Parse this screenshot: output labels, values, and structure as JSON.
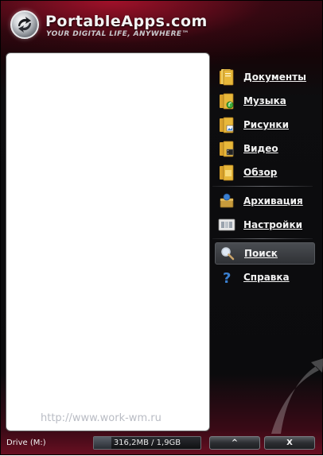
{
  "header": {
    "title": "PortableApps.com",
    "tagline": "YOUR DIGITAL LIFE, ANYWHERE™"
  },
  "app_list": {
    "watermark": "http://www.work-wm.ru"
  },
  "menu": {
    "items": [
      {
        "label": "Документы",
        "icon": "folder-documents-icon"
      },
      {
        "label": "Музыка",
        "icon": "folder-music-icon"
      },
      {
        "label": "Рисунки",
        "icon": "folder-pictures-icon"
      },
      {
        "label": "Видео",
        "icon": "folder-video-icon"
      },
      {
        "label": "Обзор",
        "icon": "folder-explore-icon"
      },
      {
        "label": "Архивация",
        "icon": "backup-icon"
      },
      {
        "label": "Настройки",
        "icon": "settings-icon"
      },
      {
        "label": "Поиск",
        "icon": "search-icon"
      },
      {
        "label": "Справка",
        "icon": "help-icon"
      }
    ],
    "active_item": "Поиск"
  },
  "footer": {
    "drive_label": "Drive (M:)",
    "storage_text": "316,2MB / 1,9GB",
    "storage_used_fraction": 0.163,
    "minimize_label": "^",
    "close_label": "X"
  },
  "colors": {
    "brand_red": "#c8102e",
    "panel_bg": "#0d0d0f",
    "menu_text": "#f2f2f2",
    "folder_yellow": "#e8b83a"
  }
}
